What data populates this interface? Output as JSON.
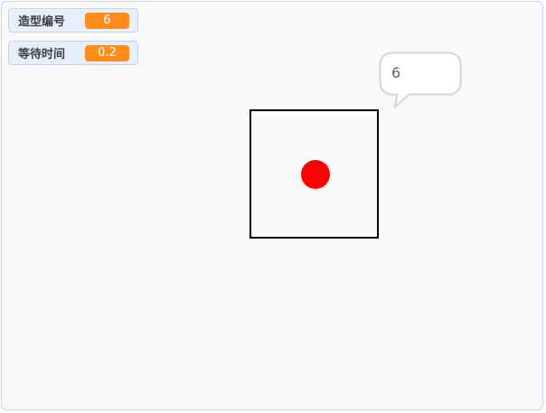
{
  "monitors": [
    {
      "label": "造型编号",
      "value": "6"
    },
    {
      "label": "等待时间",
      "value": "0.2"
    }
  ],
  "speech_bubble": {
    "text": "6"
  },
  "colors": {
    "monitor_value_bg": "#ff8c1a",
    "sprite_dot": "#ff0000",
    "sprite_border": "#000000",
    "stage_bg": "#f9f9f9"
  },
  "icons": {
    "sprite_shape": "square-with-red-dot"
  }
}
